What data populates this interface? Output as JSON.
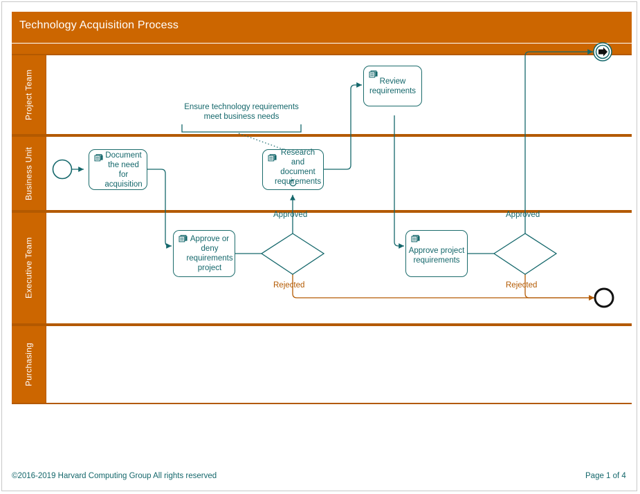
{
  "document": {
    "title": "Technology Acquisition Process",
    "page_background": "#ffffff",
    "accent_color": "#cc6600",
    "lane_border_color": "#b35900",
    "shape_color": "#14676b"
  },
  "lanes": [
    {
      "id": "project-team",
      "label": "Project Team"
    },
    {
      "id": "business-unit",
      "label": "Business Unit"
    },
    {
      "id": "executive-team",
      "label": "Executive Team"
    },
    {
      "id": "purchasing",
      "label": "Purchasing"
    }
  ],
  "events": [
    {
      "id": "start-event",
      "type": "start",
      "lane": "business-unit"
    },
    {
      "id": "link-throw-event",
      "type": "link-throw",
      "lane": "project-team"
    },
    {
      "id": "end-event",
      "type": "end",
      "lane": "executive-team"
    }
  ],
  "tasks": [
    {
      "id": "document-need",
      "label": "Document the need for acquisition",
      "lane": "business-unit",
      "icon": "manual-task-icon",
      "loop": false
    },
    {
      "id": "research-document-requirements",
      "label": "Research and document requirements",
      "lane": "business-unit",
      "icon": "manual-task-icon",
      "loop": true
    },
    {
      "id": "review-requirements",
      "label": "Review requirements",
      "lane": "project-team",
      "icon": "manual-task-icon",
      "loop": false
    },
    {
      "id": "approve-deny-requirements-project",
      "label": "Approve or deny requirements project",
      "lane": "executive-team",
      "icon": "manual-task-icon",
      "loop": false
    },
    {
      "id": "approve-project-requirements",
      "label": "Approve project requirements",
      "lane": "executive-team",
      "icon": "manual-task-icon",
      "loop": false
    }
  ],
  "gateways": [
    {
      "id": "gateway-1",
      "type": "exclusive",
      "lane": "executive-team"
    },
    {
      "id": "gateway-2",
      "type": "exclusive",
      "lane": "executive-team"
    }
  ],
  "flow_labels": [
    {
      "id": "gw1-approved",
      "text": "Approved",
      "color": "teal"
    },
    {
      "id": "gw1-rejected",
      "text": "Rejected",
      "color": "orange"
    },
    {
      "id": "gw2-approved",
      "text": "Approved",
      "color": "teal"
    },
    {
      "id": "gw2-rejected",
      "text": "Rejected",
      "color": "orange"
    }
  ],
  "annotations": [
    {
      "id": "requirements-annotation",
      "line1": "Ensure technology requirements",
      "line2": "meet business needs"
    }
  ],
  "footer": {
    "copyright": "©2016-2019 Harvard Computing Group   All rights reserved",
    "page_number": "Page 1 of 4"
  }
}
